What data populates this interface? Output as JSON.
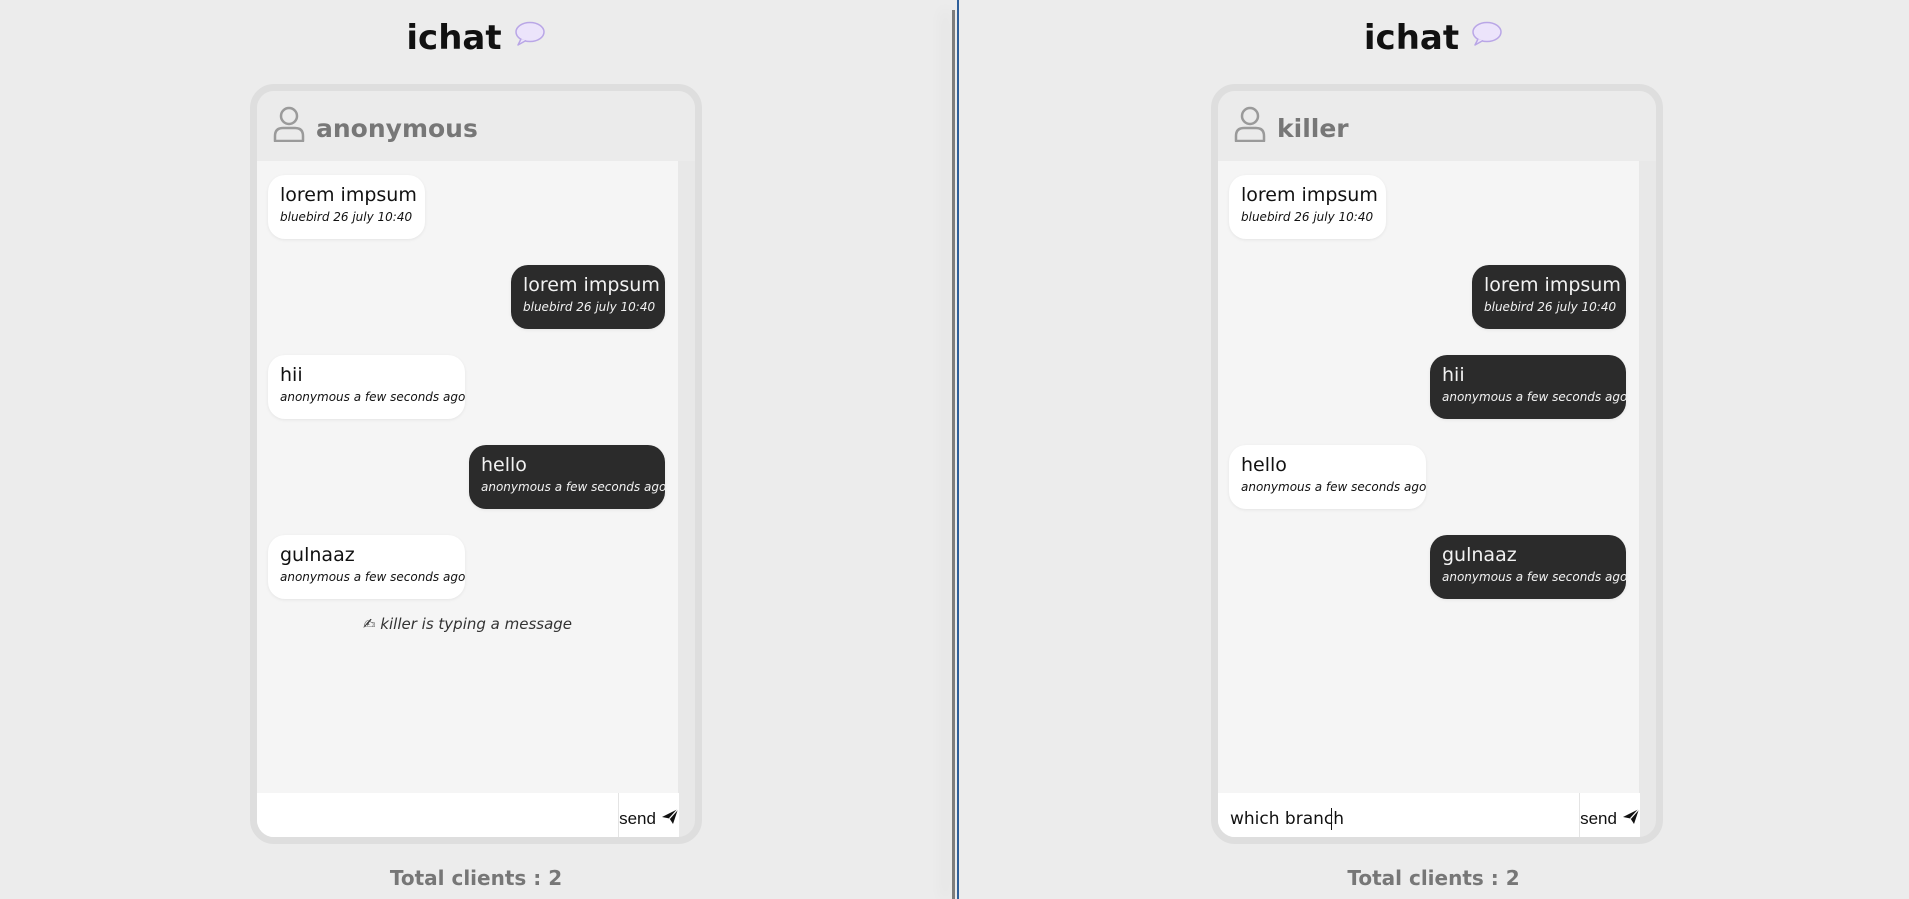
{
  "app": {
    "title": "ichat",
    "send_label": "send"
  },
  "colors": {
    "background": "#ececec",
    "incoming_bubble": "#ffffff",
    "outgoing_bubble": "#2b2b2b",
    "divider_accent": "#2f5f9a"
  },
  "left_client": {
    "username": "anonymous",
    "input_value": "",
    "typing_indicator": "✍ killer is typing a message",
    "total_clients": "Total clients : 2",
    "messages": [
      {
        "direction": "in",
        "text": "lorem impsum",
        "meta": "bluebird 26 july 10:40"
      },
      {
        "direction": "out",
        "text": "lorem impsum",
        "meta": "bluebird 26 july 10:40"
      },
      {
        "direction": "in",
        "text": "hii",
        "meta": "anonymous a few seconds ago"
      },
      {
        "direction": "out",
        "text": "hello",
        "meta": "anonymous a few seconds ago"
      },
      {
        "direction": "in",
        "text": "gulnaaz",
        "meta": "anonymous a few seconds ago"
      }
    ]
  },
  "right_client": {
    "username": "killer",
    "input_value": "which branch",
    "total_clients": "Total clients : 2",
    "messages": [
      {
        "direction": "in",
        "text": "lorem impsum",
        "meta": "bluebird 26 july 10:40"
      },
      {
        "direction": "out",
        "text": "lorem impsum",
        "meta": "bluebird 26 july 10:40"
      },
      {
        "direction": "out",
        "text": "hii",
        "meta": "anonymous a few seconds ago"
      },
      {
        "direction": "in",
        "text": "hello",
        "meta": "anonymous a few seconds ago"
      },
      {
        "direction": "out",
        "text": "gulnaaz",
        "meta": "anonymous a few seconds ago"
      }
    ]
  }
}
